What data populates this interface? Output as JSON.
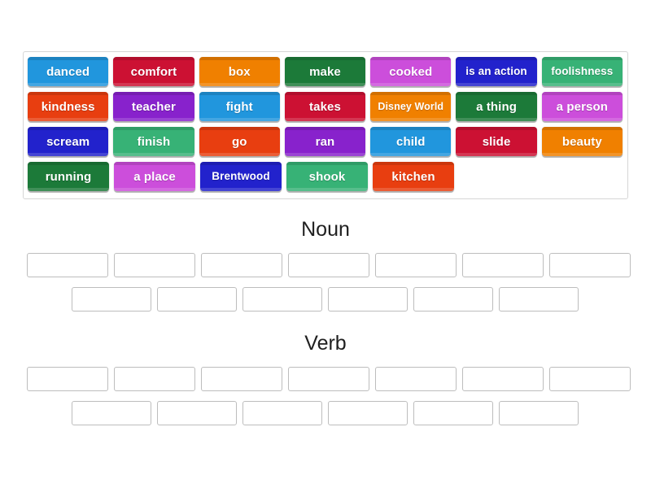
{
  "pool": {
    "name": "word-tile-pool",
    "rows": [
      [
        {
          "label": "danced",
          "color": "#2196dd",
          "size": "normal"
        },
        {
          "label": "comfort",
          "color": "#cc1133",
          "size": "normal"
        },
        {
          "label": "box",
          "color": "#f08000",
          "size": "normal"
        },
        {
          "label": "make",
          "color": "#1c7a39",
          "size": "normal"
        },
        {
          "label": "cooked",
          "color": "#cc4edb",
          "size": "normal"
        },
        {
          "label": "is an action",
          "color": "#2222cc",
          "size": "mid"
        },
        {
          "label": "foolishness",
          "color": "#37b276",
          "size": "mid"
        }
      ],
      [
        {
          "label": "kindness",
          "color": "#e83e10",
          "size": "normal"
        },
        {
          "label": "teacher",
          "color": "#8822cc",
          "size": "normal"
        },
        {
          "label": "fight",
          "color": "#2196dd",
          "size": "normal"
        },
        {
          "label": "takes",
          "color": "#cc1133",
          "size": "normal"
        },
        {
          "label": "Disney World",
          "color": "#f08000",
          "size": "small"
        },
        {
          "label": "a thing",
          "color": "#1c7a39",
          "size": "normal"
        },
        {
          "label": "a person",
          "color": "#cc4edb",
          "size": "normal"
        }
      ],
      [
        {
          "label": "scream",
          "color": "#2222cc",
          "size": "normal"
        },
        {
          "label": "finish",
          "color": "#37b276",
          "size": "normal"
        },
        {
          "label": "go",
          "color": "#e83e10",
          "size": "normal"
        },
        {
          "label": "ran",
          "color": "#8822cc",
          "size": "normal"
        },
        {
          "label": "child",
          "color": "#2196dd",
          "size": "normal"
        },
        {
          "label": "slide",
          "color": "#cc1133",
          "size": "normal"
        },
        {
          "label": "beauty",
          "color": "#f08000",
          "size": "normal"
        }
      ],
      [
        {
          "label": "running",
          "color": "#1c7a39",
          "size": "normal"
        },
        {
          "label": "a place",
          "color": "#cc4edb",
          "size": "normal"
        },
        {
          "label": "Brentwood",
          "color": "#2222cc",
          "size": "mid"
        },
        {
          "label": "shook",
          "color": "#37b276",
          "size": "normal"
        },
        {
          "label": "kitchen",
          "color": "#e83e10",
          "size": "normal"
        }
      ]
    ]
  },
  "categories": [
    {
      "title": "Noun",
      "row1_slots": 7,
      "row2_slots": 6
    },
    {
      "title": "Verb",
      "row1_slots": 7,
      "row2_slots": 6
    }
  ]
}
